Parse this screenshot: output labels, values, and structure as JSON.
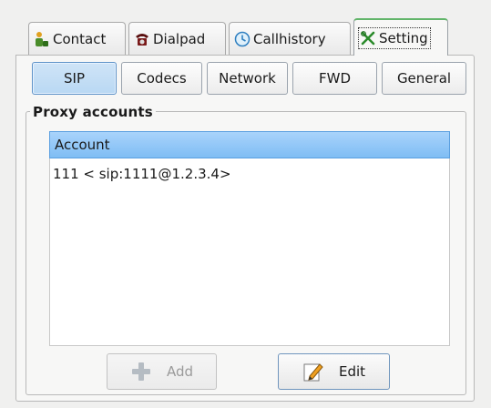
{
  "tabs": [
    {
      "label": "Contact",
      "icon": "contact-icon"
    },
    {
      "label": "Dialpad",
      "icon": "telephone-icon"
    },
    {
      "label": "Callhistory",
      "icon": "clock-icon"
    },
    {
      "label": "Setting",
      "icon": "tools-icon",
      "active": true
    }
  ],
  "subtabs": [
    {
      "label": "SIP",
      "active": true
    },
    {
      "label": "Codecs"
    },
    {
      "label": "Network"
    },
    {
      "label": "FWD"
    },
    {
      "label": "General"
    }
  ],
  "proxy": {
    "group_title": "Proxy accounts",
    "column_header": "Account",
    "accounts": [
      "111 < sip:1111@1.2.3.4>"
    ]
  },
  "buttons": {
    "add": {
      "label": "Add",
      "icon": "plus-icon",
      "enabled": false
    },
    "edit": {
      "label": "Edit",
      "icon": "edit-pencil-icon",
      "enabled": true
    }
  },
  "colors": {
    "selection_blue": "#7fbdf4",
    "active_tab_accent": "#62b56a"
  }
}
